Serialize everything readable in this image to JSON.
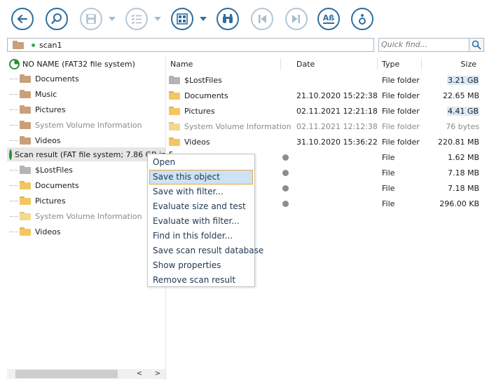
{
  "toolbar": {
    "buttons": [
      {
        "icon": "back-arrow-icon",
        "enabled": true
      },
      {
        "icon": "search-icon",
        "enabled": true
      },
      {
        "icon": "save-icon",
        "enabled": false
      },
      {
        "icon": "checklist-icon",
        "enabled": false
      },
      {
        "icon": "grid-view-icon",
        "enabled": true
      },
      {
        "icon": "binoculars-icon",
        "enabled": true
      },
      {
        "icon": "previous-icon",
        "enabled": false
      },
      {
        "icon": "next-icon",
        "enabled": false
      },
      {
        "icon": "text-encoding-icon",
        "enabled": true,
        "text": "Aß"
      },
      {
        "icon": "info-icon",
        "enabled": true
      }
    ]
  },
  "address": {
    "path": "scan1"
  },
  "quick_find": {
    "placeholder": "Quick find..."
  },
  "tree": {
    "root1": {
      "label": "NO NAME (FAT32 file system)",
      "children": [
        {
          "label": "Documents",
          "dim": false
        },
        {
          "label": "Music",
          "dim": false
        },
        {
          "label": "Pictures",
          "dim": false
        },
        {
          "label": "System Volume Information",
          "dim": true
        },
        {
          "label": "Videos",
          "dim": false
        }
      ]
    },
    "root2": {
      "label": "Scan result (FAT file system; 7.86 GB in 5",
      "children": [
        {
          "label": "$LostFiles",
          "dim": false
        },
        {
          "label": "Documents",
          "dim": false
        },
        {
          "label": "Pictures",
          "dim": false
        },
        {
          "label": "System Volume Information",
          "dim": true
        },
        {
          "label": "Videos",
          "dim": false
        }
      ]
    }
  },
  "list": {
    "columns": {
      "name": "Name",
      "date": "Date",
      "type": "Type",
      "size": "Size"
    },
    "rows": [
      {
        "name": "$LostFiles",
        "date": "",
        "type": "File folder",
        "size": "3.21 GB",
        "icon": "grey-folder-icon",
        "dim": false
      },
      {
        "name": "Documents",
        "date": "21.10.2020 15:22:38",
        "type": "File folder",
        "size": "22.65 MB",
        "icon": "folder-icon",
        "dim": false
      },
      {
        "name": "Pictures",
        "date": "02.11.2021 12:21:18",
        "type": "File folder",
        "size": "4.41 GB",
        "icon": "folder-icon",
        "dim": false
      },
      {
        "name": "System Volume Information",
        "date": "02.11.2021 12:12:38",
        "type": "File folder",
        "size": "76 bytes",
        "icon": "system-folder-icon",
        "dim": true
      },
      {
        "name": "Videos",
        "date": "31.10.2020 15:36:22",
        "type": "File folder",
        "size": "220.81 MB",
        "icon": "folder-icon",
        "dim": false
      },
      {
        "name": "",
        "date": "",
        "type": "File",
        "size": "1.62 MB",
        "icon": "file-dot-icon",
        "dim": false
      },
      {
        "name": "",
        "date": "",
        "type": "File",
        "size": "7.18 MB",
        "icon": "file-dot-icon",
        "dim": false
      },
      {
        "name": "",
        "date": "",
        "type": "File",
        "size": "7.18 MB",
        "icon": "file-dot-icon",
        "dim": false
      },
      {
        "name": "",
        "date": "",
        "type": "File",
        "size": "296.00 KB",
        "icon": "file-dot-icon",
        "dim": false
      }
    ]
  },
  "context_menu": {
    "items": [
      "Open",
      "Save this object",
      "Save with filter...",
      "Evaluate size and test",
      "Evaluate with filter...",
      "Find in this folder...",
      "Save scan result database",
      "Show properties",
      "Remove scan result"
    ],
    "active_index": 1
  },
  "colors": {
    "accent": "#2f6e9e",
    "selection": "#cde2f5",
    "focus_border": "#e5a842"
  }
}
